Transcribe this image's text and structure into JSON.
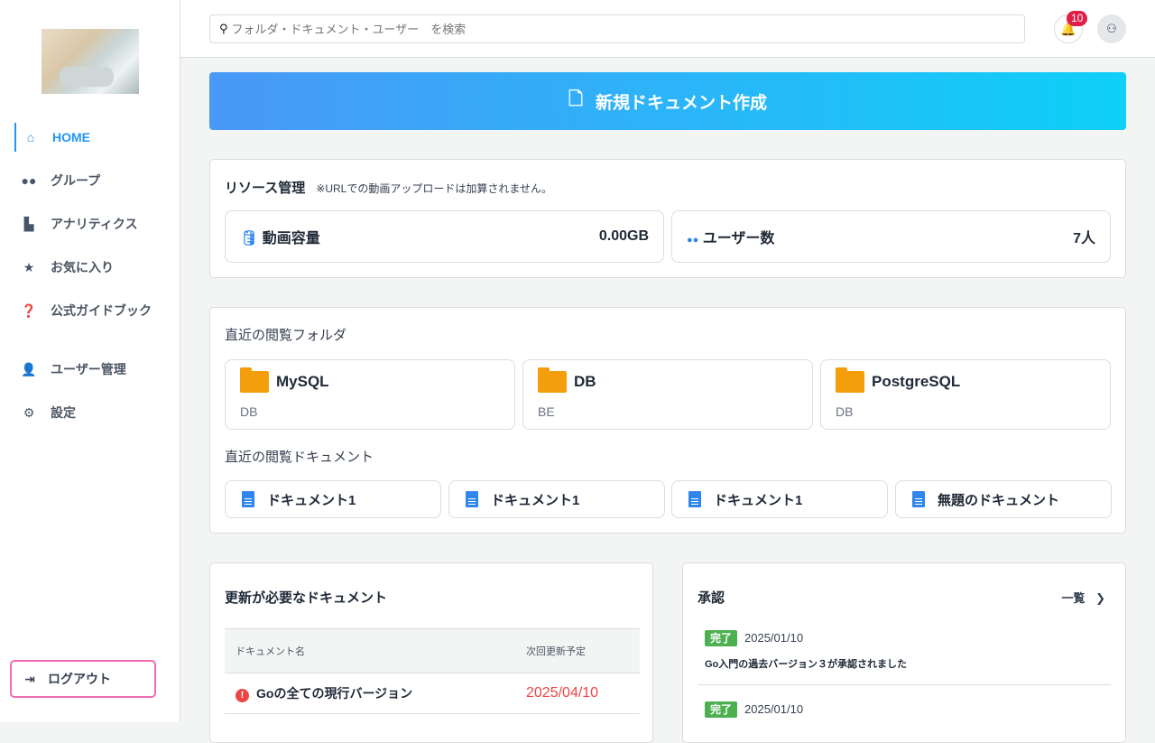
{
  "sidebar": {
    "items": [
      {
        "label": "HOME",
        "icon": "home-icon"
      },
      {
        "label": "グループ",
        "icon": "users-icon"
      },
      {
        "label": "アナリティクス",
        "icon": "chart-icon"
      },
      {
        "label": "お気に入り",
        "icon": "star-icon"
      },
      {
        "label": "公式ガイドブック",
        "icon": "question-icon"
      },
      {
        "label": "ユーザー管理",
        "icon": "user-icon"
      },
      {
        "label": "設定",
        "icon": "gear-icon"
      }
    ],
    "logout": "ログアウト"
  },
  "header": {
    "search_placeholder": "フォルダ・ドキュメント・ユーザー　を検索",
    "notifications": "10"
  },
  "banner": {
    "label": "新規ドキュメント作成"
  },
  "resources": {
    "title": "リソース管理",
    "note": "※URLでの動画アップロードは加算されません。",
    "video_label": "動画容量",
    "video_value": "0.00GB",
    "users_label": "ユーザー数",
    "users_value": "7人"
  },
  "recent": {
    "folders_title": "直近の閲覧フォルダ",
    "folders": [
      {
        "name": "MySQL",
        "sub": "DB"
      },
      {
        "name": "DB",
        "sub": "BE"
      },
      {
        "name": "PostgreSQL",
        "sub": "DB"
      }
    ],
    "docs_title": "直近の閲覧ドキュメント",
    "docs": [
      "ドキュメント1",
      "ドキュメント1",
      "ドキュメント1",
      "無題のドキュメント"
    ]
  },
  "updates": {
    "title": "更新が必要なドキュメント",
    "col_name": "ドキュメント名",
    "col_date": "次回更新予定",
    "rows": [
      {
        "name": "Goの全ての現行バージョン",
        "date": "2025/04/10"
      }
    ]
  },
  "approval": {
    "title": "承認",
    "list_link": "一覧",
    "items": [
      {
        "tag": "完了",
        "date": "2025/01/10",
        "text": "Go入門の過去バージョン３が承認されました"
      },
      {
        "tag": "完了",
        "date": "2025/01/10"
      }
    ]
  }
}
